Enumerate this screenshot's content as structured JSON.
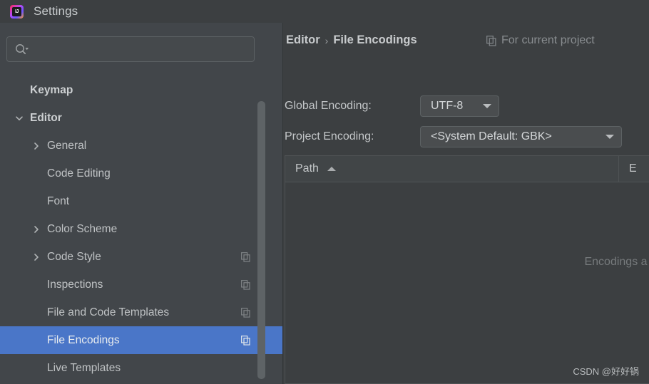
{
  "window": {
    "title": "Settings",
    "logo_text": "IJ",
    "logo_icon": "intellij-idea-logo"
  },
  "sidebar": {
    "search": {
      "value": "",
      "placeholder": "",
      "icon": "search-icon"
    },
    "items": [
      {
        "label": "Keymap",
        "indent": 0,
        "bold": true,
        "chevron": "none",
        "selected": false,
        "copy_icon": false
      },
      {
        "label": "Editor",
        "indent": 0,
        "bold": true,
        "chevron": "down",
        "selected": false,
        "copy_icon": false
      },
      {
        "label": "General",
        "indent": 1,
        "bold": false,
        "chevron": "right",
        "selected": false,
        "copy_icon": false
      },
      {
        "label": "Code Editing",
        "indent": 1,
        "bold": false,
        "chevron": "none",
        "selected": false,
        "copy_icon": false
      },
      {
        "label": "Font",
        "indent": 1,
        "bold": false,
        "chevron": "none",
        "selected": false,
        "copy_icon": false
      },
      {
        "label": "Color Scheme",
        "indent": 1,
        "bold": false,
        "chevron": "right",
        "selected": false,
        "copy_icon": false
      },
      {
        "label": "Code Style",
        "indent": 1,
        "bold": false,
        "chevron": "right",
        "selected": false,
        "copy_icon": true
      },
      {
        "label": "Inspections",
        "indent": 1,
        "bold": false,
        "chevron": "none",
        "selected": false,
        "copy_icon": true
      },
      {
        "label": "File and Code Templates",
        "indent": 1,
        "bold": false,
        "chevron": "none",
        "selected": false,
        "copy_icon": true
      },
      {
        "label": "File Encodings",
        "indent": 1,
        "bold": false,
        "chevron": "none",
        "selected": true,
        "copy_icon": true
      },
      {
        "label": "Live Templates",
        "indent": 1,
        "bold": false,
        "chevron": "none",
        "selected": false,
        "copy_icon": false
      }
    ],
    "scrollbar": {
      "visible": true
    }
  },
  "main": {
    "breadcrumb": {
      "parent": "Editor",
      "separator": "›",
      "current": "File Encodings"
    },
    "for_current_project": {
      "label": "For current project",
      "icon": "copy-settings-icon"
    },
    "global_encoding": {
      "label": "Global Encoding:",
      "value": "UTF-8"
    },
    "project_encoding": {
      "label": "Project Encoding:",
      "value": "<System Default: GBK>"
    },
    "table": {
      "columns": [
        {
          "label": "Path",
          "sort": "asc"
        },
        {
          "label": "E"
        }
      ],
      "rows": [],
      "empty_text": "Encodings a"
    }
  },
  "annotation": {
    "shape": "hand-drawn-ellipse",
    "color": "#f41414",
    "target": "global-encoding-combo"
  },
  "watermark": {
    "text": "CSDN @好好锅"
  },
  "colors": {
    "window_bg": "#3c3f41",
    "sidebar_bg": "#42464a",
    "selection_blue": "#4a76c8",
    "text_primary": "#c8cbcd",
    "text_muted": "#898d90",
    "border": "#4f5355",
    "annotation_red": "#f41414"
  }
}
